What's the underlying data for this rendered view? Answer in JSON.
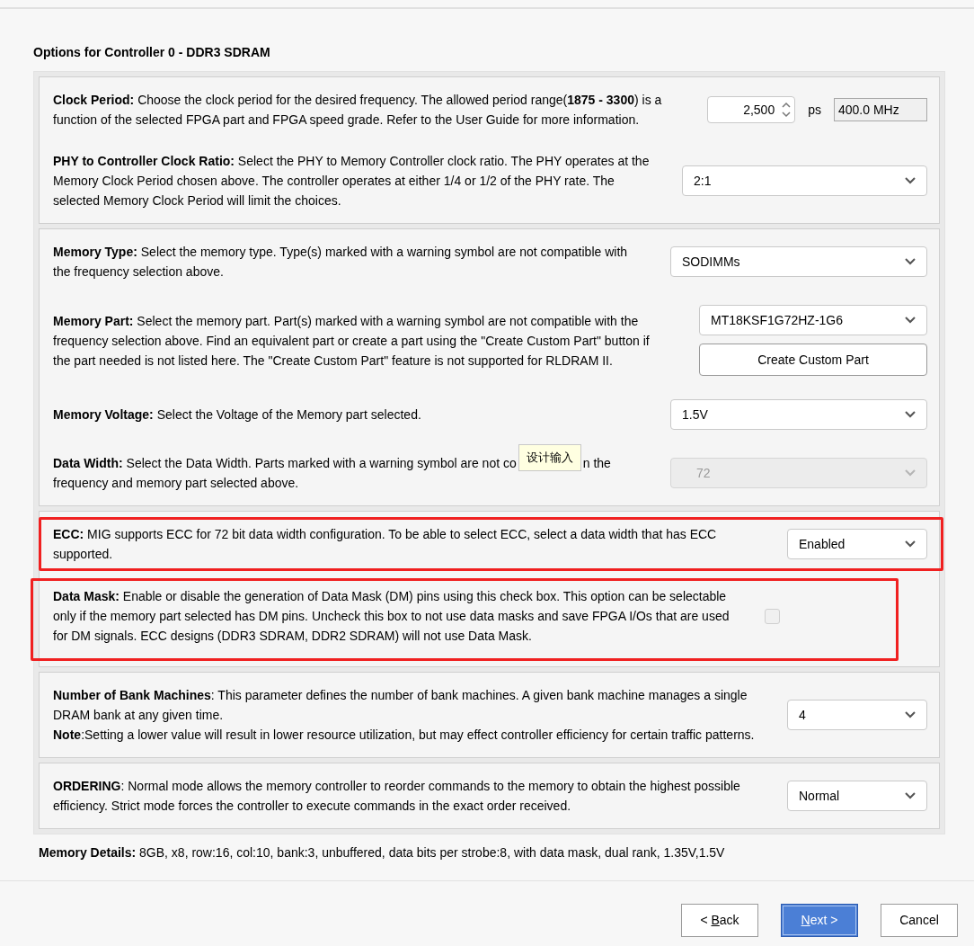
{
  "title": "Options for Controller 0 - DDR3 SDRAM",
  "groups": [
    {
      "options": [
        {
          "kind": "spinner",
          "text": [
            "**Clock Period:** Choose the clock period for the desired frequency. The allowed period range(**1875 - 3300**) is a function of the selected FPGA part and FPGA speed grade. Refer to the User Guide for more information."
          ],
          "value": "2,500",
          "unit": "ps",
          "frequency": "400.0 MHz",
          "highlighted": false
        },
        {
          "kind": "select",
          "text": [
            "**PHY to Controller Clock Ratio:** Select the PHY to Memory Controller clock ratio. The PHY operates at the Memory Clock Period chosen above. The controller operates at either 1/4 or 1/2 of the PHY rate. The selected Memory Clock Period will limit the choices."
          ],
          "value": "2:1",
          "disabled": false,
          "highlighted": false
        }
      ]
    },
    {
      "options": [
        {
          "kind": "select",
          "text": [
            "**Memory Type:** Select the memory type. Type(s) marked with a warning symbol are not compatible with the frequency selection above."
          ],
          "value": "SODIMMs",
          "disabled": false,
          "highlighted": false
        },
        {
          "kind": "select_button",
          "text": [
            "**Memory Part:** Select the memory part. Part(s) marked with a warning symbol are not compatible with the frequency selection above. Find an equivalent part or create a part using the \"Create Custom Part\" button if the part needed is not listed here. The \"Create Custom Part\" feature is not supported for RLDRAM II."
          ],
          "value": "MT18KSF1G72HZ-1G6",
          "disabled": false,
          "button": "Create Custom Part",
          "highlighted": false
        },
        {
          "kind": "select",
          "text": [
            "**Memory Voltage:** Select the Voltage of the Memory part selected."
          ],
          "value": "1.5V",
          "disabled": false,
          "highlighted": false
        },
        {
          "kind": "select",
          "text": [
            "**Data Width:** Select the Data Width. Parts marked with a warning symbol are not co",
            "n the frequency and memory part selected above."
          ],
          "tooltip": "设计输入",
          "value": "72",
          "disabled": true,
          "highlighted": false
        }
      ]
    },
    {
      "options": [
        {
          "kind": "select",
          "text": [
            "**ECC:** MIG supports ECC for 72 bit data width configuration. To be able to select ECC, select a data width that has ECC supported."
          ],
          "value": "Enabled",
          "disabled": false,
          "highlighted": true
        },
        {
          "kind": "checkbox",
          "text": [
            "**Data Mask:** Enable or disable the generation of Data Mask (DM) pins using this check box. This option can be selectable only if the memory part selected has DM pins. Uncheck this box to not use data masks and save FPGA I/Os that are used for DM signals. ECC designs (DDR3 SDRAM, DDR2 SDRAM) will not use Data Mask."
          ],
          "checked": false,
          "disabled": true,
          "highlighted": true
        }
      ]
    },
    {
      "options": [
        {
          "kind": "select",
          "text": [
            "**Number of Bank Machines**: This parameter defines the number of bank machines. A given bank machine manages a single DRAM bank at any given time.",
            "**Note**:Setting a lower value will result in lower resource utilization, but may effect controller efficiency for certain traffic patterns."
          ],
          "value": "4",
          "disabled": false,
          "highlighted": false
        }
      ]
    },
    {
      "options": [
        {
          "kind": "select",
          "text": [
            "**ORDERING**: Normal mode allows the memory controller to reorder commands to the memory to obtain the highest possible efficiency. Strict mode forces the controller to execute commands in the exact order received."
          ],
          "value": "Normal",
          "disabled": false,
          "highlighted": false
        }
      ]
    }
  ],
  "memory_details": "**Memory Details:** 8GB, x8, row:16, col:10, bank:3, unbuffered, data bits per strobe:8, with data mask, dual rank, 1.35V,1.5V",
  "buttons": [
    {
      "label_before": "< ",
      "mnemonic": "B",
      "label_after": "ack",
      "primary": false
    },
    {
      "mnemonic": "N",
      "label_after": "ext >",
      "primary": true
    },
    {
      "label_before": "Cancel",
      "primary": false
    }
  ]
}
